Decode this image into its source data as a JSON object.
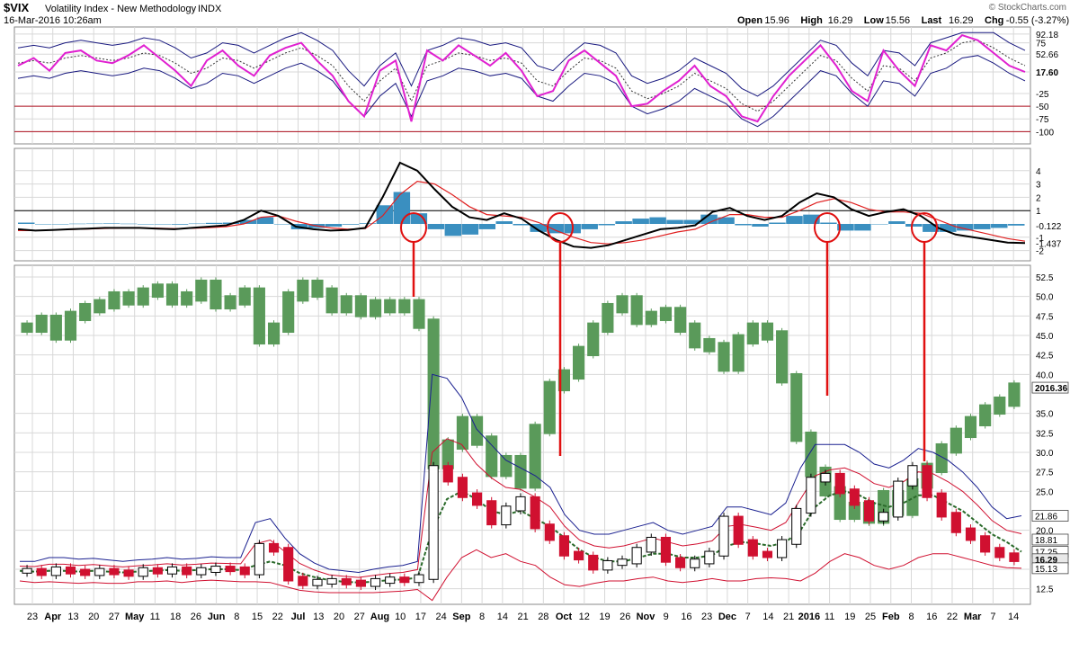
{
  "header": {
    "symbol": "$VIX",
    "name": "Volatility Index - New Methodology",
    "exchange": "INDX",
    "date": "16-Mar-2016 10:26am",
    "watermark": "© StockCharts.com",
    "stats": [
      {
        "label": "Open",
        "value": "15.96"
      },
      {
        "label": "High",
        "value": "16.29"
      },
      {
        "label": "Low",
        "value": "15.56"
      },
      {
        "label": "Last",
        "value": "16.29"
      },
      {
        "label": "Chg",
        "value": "-0.55 (-3.27%)"
      }
    ]
  },
  "chart_data": [
    {
      "type": "line",
      "panel": "top-oscillator",
      "y_ticks": [
        "92.18",
        "75",
        "52.66",
        "17.60",
        "-25",
        "-50",
        "-75",
        "-100"
      ],
      "reference_lines": [
        -50,
        -100
      ],
      "current_value": "17.60",
      "series": [
        {
          "role": "oscillator",
          "values": [
            30,
            45,
            20,
            55,
            60,
            40,
            35,
            50,
            70,
            45,
            20,
            -10,
            40,
            60,
            30,
            10,
            50,
            65,
            75,
            40,
            10,
            -40,
            -70,
            20,
            40,
            -80,
            60,
            40,
            70,
            50,
            30,
            55,
            20,
            -30,
            -20,
            40,
            60,
            35,
            10,
            -50,
            -45,
            -20,
            0,
            30,
            -10,
            -30,
            -70,
            -80,
            -30,
            10,
            40,
            70,
            30,
            -20,
            -40,
            60,
            20,
            -10,
            70,
            60,
            90,
            80,
            55,
            30,
            17.6
          ]
        },
        {
          "role": "signal",
          "values": [
            35,
            40,
            35,
            45,
            50,
            45,
            40,
            45,
            55,
            50,
            35,
            15,
            25,
            45,
            40,
            25,
            40,
            55,
            65,
            50,
            30,
            -10,
            -40,
            0,
            25,
            -40,
            30,
            40,
            55,
            50,
            40,
            45,
            35,
            0,
            -10,
            20,
            45,
            40,
            25,
            -20,
            -35,
            -25,
            -10,
            15,
            0,
            -15,
            -45,
            -60,
            -40,
            -10,
            20,
            50,
            40,
            5,
            -20,
            30,
            25,
            0,
            45,
            55,
            75,
            80,
            65,
            45,
            30
          ]
        }
      ]
    },
    {
      "type": "line",
      "panel": "middle-macd",
      "y_ticks": [
        "4",
        "3",
        "2",
        "1",
        "-0.122",
        "-1",
        "-1.437",
        "-2"
      ],
      "reference_lines": [
        1
      ],
      "current_values": [
        "-0.122",
        "-1.437"
      ],
      "series": [
        {
          "role": "macd",
          "values": [
            -0.4,
            -0.5,
            -0.45,
            -0.4,
            -0.35,
            -0.3,
            -0.3,
            -0.3,
            -0.35,
            -0.4,
            -0.3,
            -0.2,
            -0.1,
            0.3,
            1.0,
            0.6,
            -0.2,
            -0.4,
            -0.5,
            -0.45,
            -0.3,
            2.0,
            4.6,
            4.0,
            2.6,
            1.3,
            0.5,
            0.3,
            0.8,
            0.4,
            -0.5,
            -1.2,
            -1.7,
            -1.8,
            -1.6,
            -1.2,
            -0.8,
            -0.4,
            -0.3,
            -0.1,
            0.9,
            1.2,
            0.6,
            0.3,
            0.6,
            1.6,
            2.3,
            2.0,
            1.1,
            0.6,
            0.9,
            1.1,
            0.6,
            -0.3,
            -0.8,
            -1.0,
            -1.2,
            -1.4,
            -1.437
          ]
        },
        {
          "role": "signal",
          "values": [
            -0.5,
            -0.5,
            -0.45,
            -0.42,
            -0.38,
            -0.34,
            -0.32,
            -0.3,
            -0.32,
            -0.35,
            -0.33,
            -0.28,
            -0.2,
            0.0,
            0.5,
            0.6,
            0.2,
            -0.1,
            -0.3,
            -0.4,
            -0.35,
            0.6,
            2.2,
            3.2,
            3.0,
            2.2,
            1.3,
            0.7,
            0.6,
            0.5,
            0.1,
            -0.5,
            -1.0,
            -1.4,
            -1.5,
            -1.4,
            -1.2,
            -0.9,
            -0.6,
            -0.4,
            0.2,
            0.7,
            0.7,
            0.5,
            0.5,
            1.0,
            1.6,
            1.9,
            1.6,
            1.1,
            0.9,
            0.9,
            0.8,
            0.3,
            -0.2,
            -0.5,
            -0.8,
            -1.1,
            -1.3
          ]
        },
        {
          "role": "histogram",
          "values": [
            0.1,
            0.0,
            0.0,
            0.02,
            0.03,
            0.04,
            0.02,
            0.0,
            -0.03,
            -0.05,
            0.03,
            0.08,
            0.1,
            0.3,
            0.5,
            0.0,
            -0.4,
            -0.3,
            -0.2,
            -0.05,
            0.05,
            1.4,
            2.4,
            0.8,
            -0.4,
            -0.9,
            -0.8,
            -0.4,
            0.2,
            -0.1,
            -0.6,
            -0.7,
            -0.7,
            -0.4,
            -0.1,
            0.2,
            0.4,
            0.5,
            0.3,
            0.3,
            0.7,
            0.5,
            -0.1,
            -0.2,
            0.1,
            0.6,
            0.7,
            0.1,
            -0.5,
            -0.5,
            0.0,
            0.2,
            -0.2,
            -0.6,
            -0.6,
            -0.5,
            -0.4,
            -0.3,
            -0.122
          ]
        }
      ]
    },
    {
      "type": "line",
      "panel": "main-price",
      "y_ticks": [
        "52.5",
        "50.0",
        "47.5",
        "45.0",
        "42.5",
        "40.0",
        "35.0",
        "32.5",
        "30.0",
        "27.5",
        "25.0",
        "20.0",
        "15.0",
        "12.5"
      ],
      "price_labels": [
        {
          "value": "2016.36",
          "scale": 38.3
        },
        {
          "value": "21.86",
          "scale": 21.86
        },
        {
          "value": "18.81",
          "scale": 18.81
        },
        {
          "value": "17.25",
          "scale": 17.25
        },
        {
          "value": "16.29",
          "scale": 16.29
        },
        {
          "value": "15.13",
          "scale": 15.13
        }
      ],
      "x_tick_labels": [
        "23",
        "Apr",
        "13",
        "20",
        "27",
        "May",
        "11",
        "18",
        "26",
        "Jun",
        "8",
        "15",
        "22",
        "Jul",
        "13",
        "20",
        "27",
        "Aug",
        "10",
        "17",
        "24",
        "Sep",
        "8",
        "14",
        "21",
        "28",
        "Oct",
        "12",
        "19",
        "26",
        "Nov",
        "9",
        "16",
        "23",
        "Dec",
        "7",
        "14",
        "21",
        "2016",
        "11",
        "19",
        "25",
        "Feb",
        "8",
        "16",
        "22",
        "Mar",
        "7",
        "14"
      ],
      "series": [
        {
          "role": "vix",
          "values": [
            14.8,
            14.5,
            15.0,
            14.7,
            14.5,
            14.8,
            14.6,
            14.4,
            14.9,
            14.7,
            15.0,
            14.6,
            14.9,
            15.1,
            15.0,
            14.6,
            18.0,
            17.5,
            13.8,
            13.2,
            13.4,
            13.5,
            13.3,
            13.1,
            13.5,
            13.7,
            13.6,
            14.0,
            28.0,
            26.5,
            24.5,
            23.5,
            21.0,
            22.8,
            24.0,
            20.5,
            19.0,
            17.0,
            16.5,
            15.2,
            15.8,
            16.0,
            17.5,
            18.8,
            16.2,
            15.5,
            16.0,
            17.0,
            21.5,
            18.5,
            17.0,
            16.8,
            18.5,
            22.5,
            26.5,
            27.0,
            25.0,
            23.5,
            21.5,
            22.0,
            26.0,
            28.0,
            24.5,
            22.0,
            20.0,
            19.0,
            17.5,
            16.8,
            16.29
          ]
        },
        {
          "role": "spx",
          "values": [
            46.0,
            47.0,
            45.0,
            47.5,
            48.5,
            49.0,
            50.0,
            49.5,
            50.5,
            51.0,
            49.5,
            50.0,
            51.5,
            49.0,
            49.5,
            50.5,
            44.5,
            46.0,
            50.0,
            51.5,
            50.5,
            48.5,
            49.5,
            48.0,
            49.0,
            48.5,
            49.0,
            46.5,
            28.5,
            31.0,
            34.0,
            31.5,
            27.5,
            29.0,
            26.0,
            33.0,
            38.5,
            40.0,
            43.0,
            46.0,
            48.5,
            49.5,
            47.0,
            47.5,
            48.0,
            46.0,
            44.0,
            43.5,
            41.0,
            44.5,
            46.0,
            45.0,
            39.5,
            32.0,
            27.5,
            25.0,
            22.0,
            23.0,
            21.5,
            24.5,
            22.5,
            26.0,
            28.0,
            30.5,
            32.5,
            34.0,
            35.5,
            36.5,
            38.3
          ]
        },
        {
          "role": "bb-upper-vix",
          "values": [
            16.0,
            16.0,
            16.5,
            16.5,
            16.3,
            16.4,
            16.2,
            16.0,
            16.2,
            16.3,
            16.5,
            16.3,
            16.4,
            16.6,
            16.5,
            16.5,
            21.0,
            21.5,
            19.0,
            17.0,
            15.8,
            15.0,
            14.8,
            14.6,
            15.0,
            15.3,
            15.5,
            16.0,
            40.0,
            39.5,
            37.0,
            33.0,
            31.0,
            29.0,
            28.0,
            27.0,
            25.5,
            22.0,
            20.0,
            19.5,
            19.5,
            20.0,
            20.5,
            21.0,
            20.0,
            19.5,
            20.0,
            20.5,
            23.0,
            23.0,
            22.5,
            22.0,
            23.5,
            28.0,
            31.0,
            31.0,
            31.0,
            30.0,
            28.5,
            28.0,
            29.0,
            30.5,
            30.0,
            29.0,
            27.5,
            25.5,
            23.0,
            21.5,
            21.86
          ]
        },
        {
          "role": "bb-lower-vix",
          "values": [
            13.5,
            13.3,
            13.4,
            13.3,
            13.2,
            13.3,
            13.2,
            13.2,
            13.4,
            13.4,
            13.5,
            13.3,
            13.5,
            13.6,
            13.5,
            13.4,
            13.4,
            13.3,
            12.8,
            12.3,
            12.1,
            12.0,
            12.0,
            12.0,
            12.0,
            12.1,
            12.2,
            12.4,
            11.0,
            14.0,
            16.5,
            17.5,
            16.5,
            17.0,
            16.0,
            15.5,
            14.0,
            13.0,
            12.8,
            13.2,
            13.5,
            13.5,
            13.8,
            14.0,
            13.5,
            13.3,
            13.5,
            13.8,
            13.5,
            13.5,
            13.8,
            13.9,
            13.8,
            13.5,
            14.5,
            16.0,
            17.0,
            16.5,
            15.5,
            15.0,
            15.5,
            16.5,
            17.0,
            17.0,
            16.5,
            16.0,
            15.5,
            15.2,
            15.13
          ]
        },
        {
          "role": "ma-vix",
          "values": [
            14.8,
            14.7,
            14.8,
            14.8,
            14.7,
            14.8,
            14.7,
            14.6,
            14.7,
            14.8,
            14.9,
            14.8,
            14.9,
            15.0,
            15.0,
            14.9,
            15.5,
            16.0,
            15.5,
            14.5,
            14.0,
            13.6,
            13.4,
            13.3,
            13.4,
            13.6,
            13.7,
            13.9,
            20.0,
            24.0,
            25.0,
            24.0,
            22.5,
            22.0,
            22.5,
            21.5,
            20.5,
            19.0,
            17.5,
            16.5,
            16.0,
            16.0,
            16.5,
            17.0,
            17.0,
            16.5,
            16.5,
            16.8,
            18.0,
            18.5,
            18.3,
            18.0,
            18.5,
            20.0,
            23.0,
            24.5,
            25.0,
            24.5,
            23.5,
            23.0,
            23.5,
            24.5,
            24.5,
            23.5,
            22.5,
            21.0,
            19.5,
            18.5,
            17.25
          ]
        }
      ],
      "annotations": [
        {
          "type": "circle",
          "panel": "macd"
        },
        {
          "type": "circle",
          "panel": "macd"
        },
        {
          "type": "circle",
          "panel": "macd"
        },
        {
          "type": "circle",
          "panel": "macd"
        }
      ]
    }
  ],
  "colors": {
    "background": "#ffffff",
    "grid": "#d8d8d8",
    "oscillator": "#e020d0",
    "bands": "#1a1a80",
    "reference": "#b01020",
    "histogram": "#3a8fc0",
    "macd": "#000000",
    "macd_signal": "#e02020",
    "spx": "#5a9a5a",
    "candle_up": "#000000",
    "candle_down": "#d01030",
    "bb_upper": "#1a2090",
    "bb_red": "#d01030",
    "ma": "#2a6a2a",
    "annotation": "#e01010"
  }
}
